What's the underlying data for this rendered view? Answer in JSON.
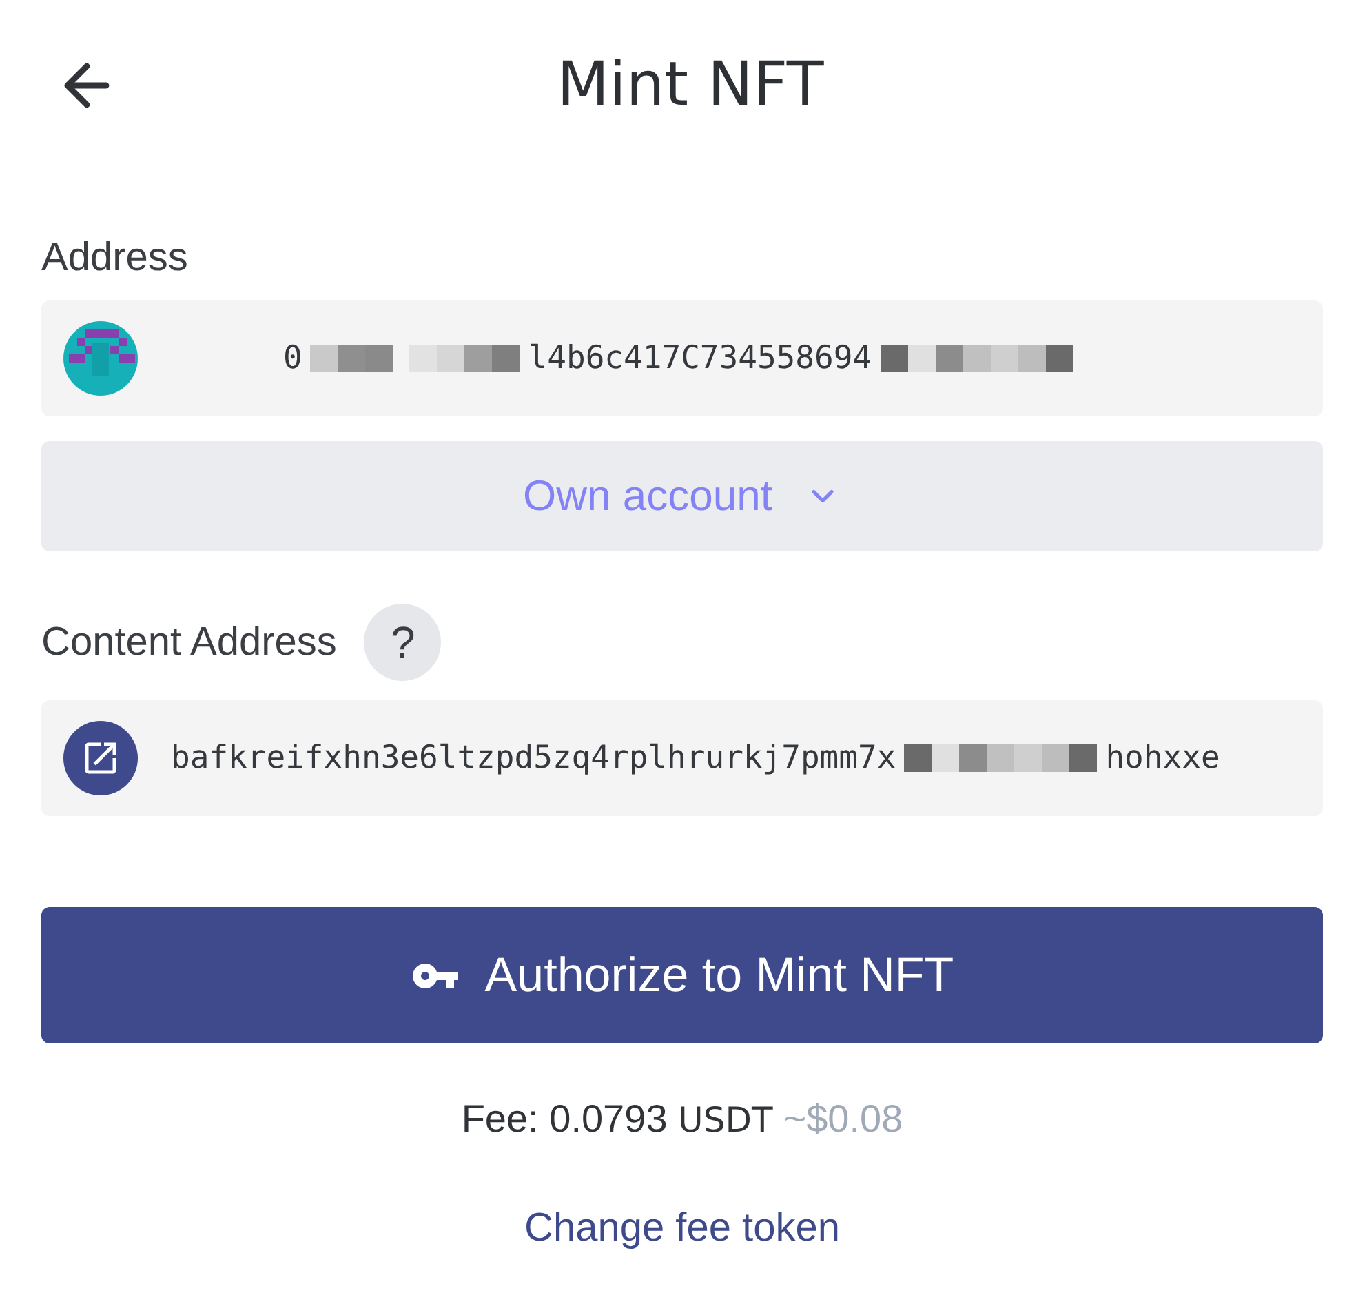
{
  "header": {
    "title": "Mint NFT"
  },
  "address": {
    "label": "Address",
    "segments": [
      {
        "kind": "text",
        "text": "0"
      },
      {
        "kind": "redacted"
      },
      {
        "kind": "redacted"
      },
      {
        "kind": "text",
        "text": "l4b6c417C734558694"
      },
      {
        "kind": "redacted"
      }
    ]
  },
  "account_select": {
    "label": "Own account"
  },
  "content_address": {
    "label": "Content Address",
    "help": "?",
    "segments": [
      {
        "kind": "text",
        "text": "bafkreifxhn3e6ltzpd5zq4rplhrurkj7pmm7x"
      },
      {
        "kind": "redacted"
      },
      {
        "kind": "text",
        "text": "hohxxe"
      }
    ]
  },
  "submit_button": {
    "label": "Authorize to Mint NFT"
  },
  "fee": {
    "amount": "Fee: 0.0793",
    "token": "USDT",
    "estimate": "~$0.08"
  },
  "change_fee_link": {
    "label": "Change fee token"
  }
}
